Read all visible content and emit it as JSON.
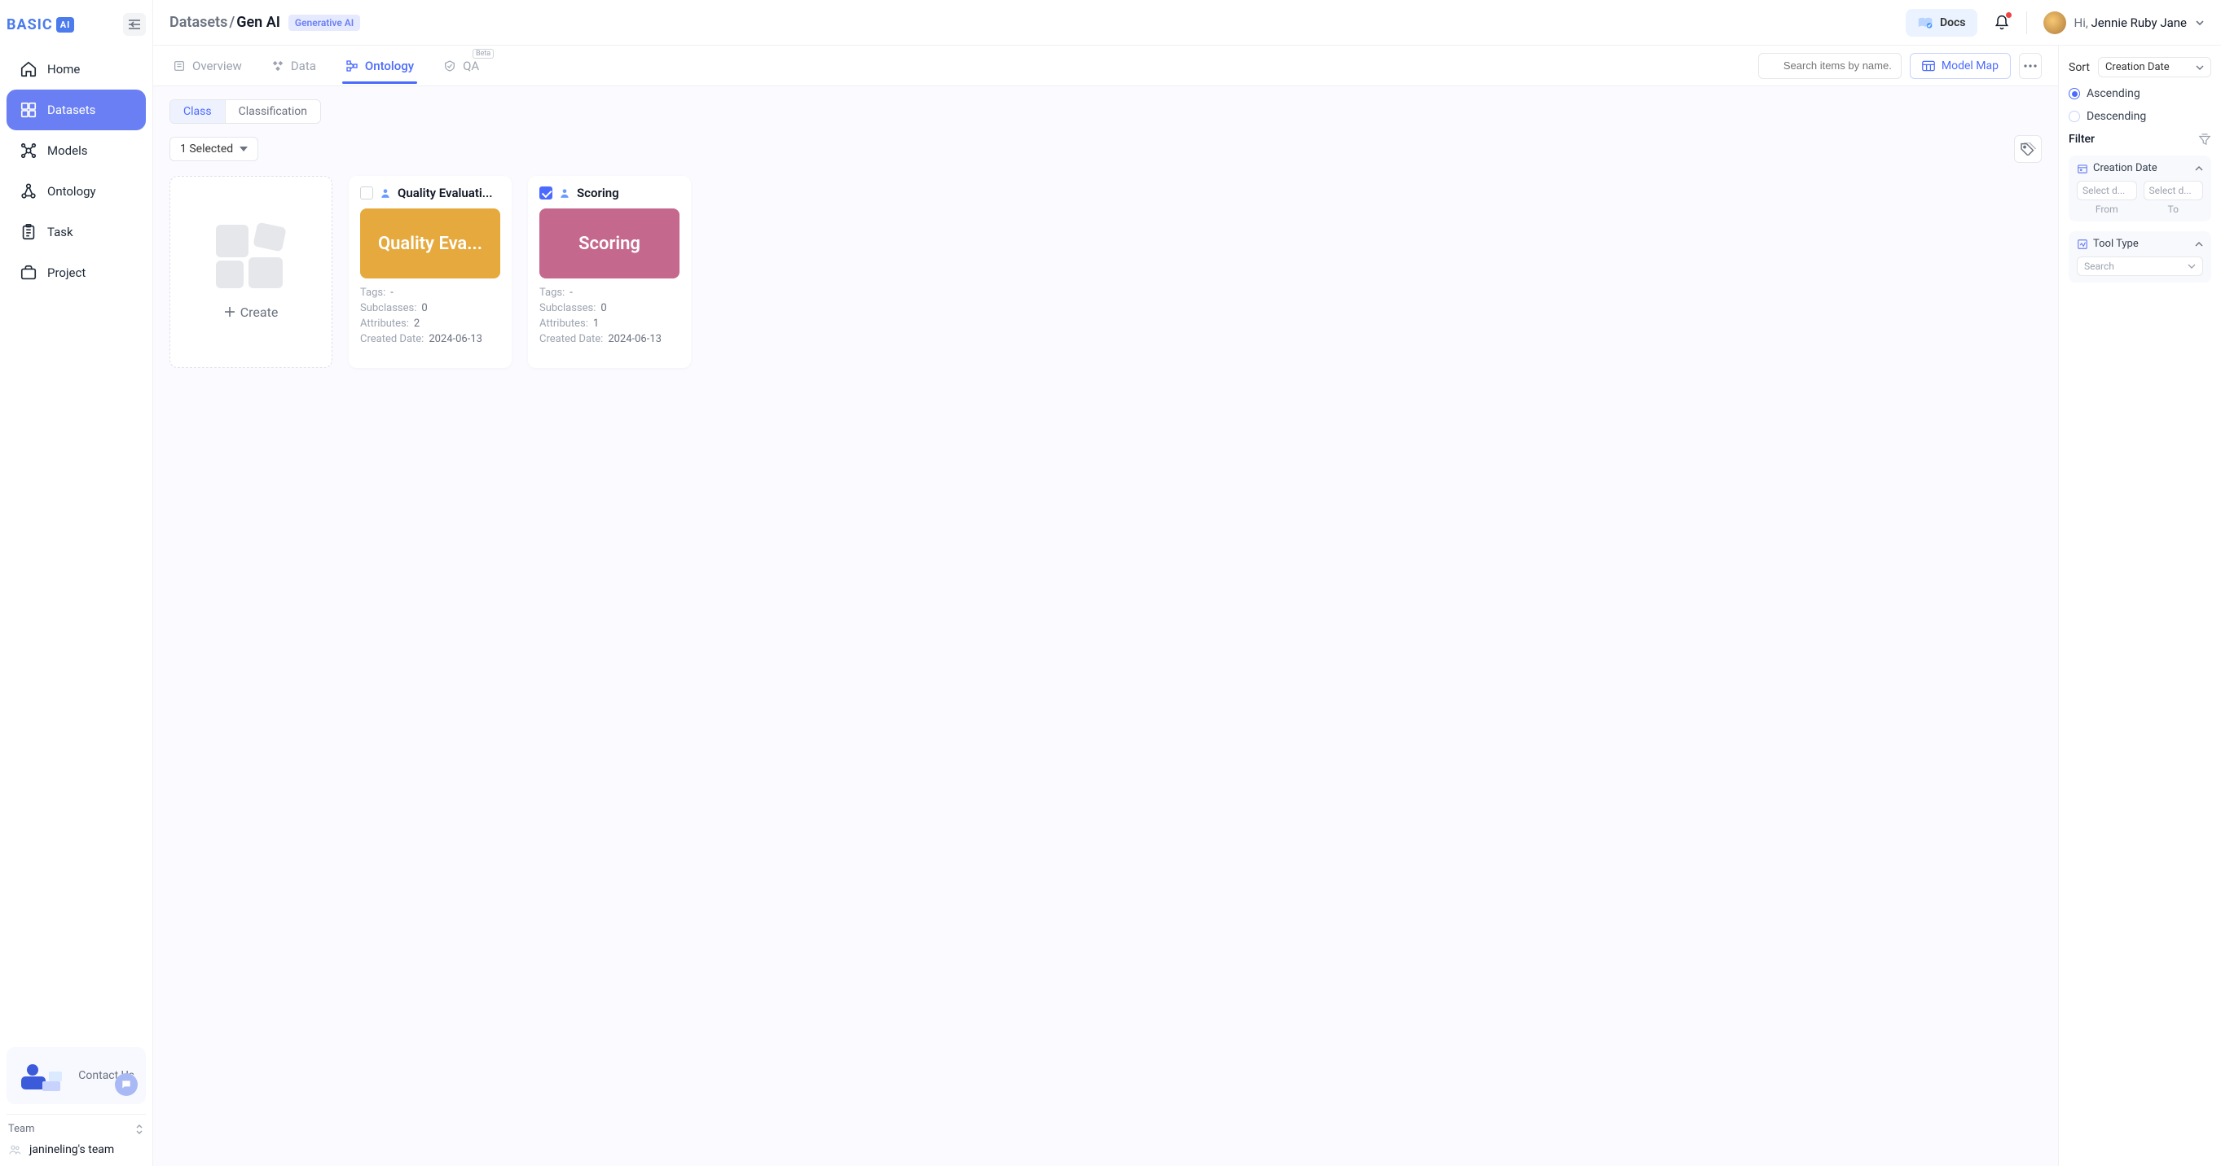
{
  "sidebar": {
    "nav": [
      {
        "label": "Home"
      },
      {
        "label": "Datasets"
      },
      {
        "label": "Models"
      },
      {
        "label": "Ontology"
      },
      {
        "label": "Task"
      },
      {
        "label": "Project"
      }
    ],
    "contact_label": "Contact Us",
    "team_label": "Team",
    "team_name": "janineling's team"
  },
  "header": {
    "breadcrumb_root": "Datasets",
    "breadcrumb_sep": "/",
    "breadcrumb_cur": "Gen AI",
    "dataset_tag": "Generative AI",
    "docs_label": "Docs",
    "greeting_prefix": "Hi, ",
    "user_name": "Jennie Ruby Jane"
  },
  "tabs": {
    "overview": "Overview",
    "data": "Data",
    "ontology": "Ontology",
    "qa": "QA",
    "beta": "Beta",
    "search_placeholder": "Search items by name...",
    "model_map": "Model Map"
  },
  "workspace": {
    "segments": {
      "class": "Class",
      "classification": "Classification"
    },
    "selected_label": "1 Selected",
    "create_label": "Create",
    "meta_labels": {
      "tags": "Tags:",
      "subclasses": "Subclasses:",
      "attributes": "Attributes:",
      "created": "Created Date:"
    },
    "cards": [
      {
        "title": "Quality Evaluati...",
        "banner_text": "Quality Eva...",
        "banner_color": "#e6a93d",
        "checked": false,
        "tags": "-",
        "subclasses": "0",
        "attributes": "2",
        "created": "2024-06-13"
      },
      {
        "title": "Scoring",
        "banner_text": "Scoring",
        "banner_color": "#c5688d",
        "checked": true,
        "tags": "-",
        "subclasses": "0",
        "attributes": "1",
        "created": "2024-06-13"
      }
    ]
  },
  "rpanel": {
    "sort_label": "Sort",
    "sort_value": "Creation Date",
    "asc_label": "Ascending",
    "desc_label": "Descending",
    "filter_label": "Filter",
    "creation_group": "Creation Date",
    "date_placeholder": "Select d...",
    "from_label": "From",
    "to_label": "To",
    "tooltype_group": "Tool Type",
    "search_placeholder": "Search"
  }
}
